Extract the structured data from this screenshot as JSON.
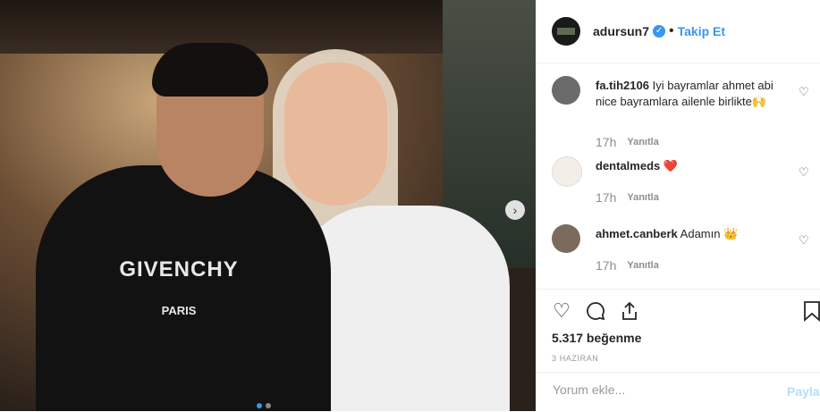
{
  "photo": {
    "shirt_logo": "GIVENCHY",
    "shirt_sub": "PARIS",
    "next_icon": "chevron-right-icon",
    "carousel_dots": 2,
    "active_dot": 0
  },
  "header": {
    "username": "adursun7",
    "verified_icon": "verified-badge-icon",
    "separator": "•",
    "follow_label": "Takip Et"
  },
  "comments": [
    {
      "username": "fa.tih2106",
      "text": "Iyi bayramlar ahmet abi nice bayramlara ailenle birlikte🙌",
      "time": "17h",
      "reply": "Yanıtla"
    },
    {
      "username": "dentalmeds",
      "text": "❤️",
      "time": "17h",
      "reply": "Yanıtla"
    },
    {
      "username": "ahmet.canberk",
      "text": "Adamın 👑",
      "time": "17h",
      "reply": "Yanıtla"
    }
  ],
  "actions": {
    "likes": "5.317 beğenme",
    "date": "3 HAZİRAN"
  },
  "composer": {
    "placeholder": "Yorum ekle...",
    "post_label": "Paylaş"
  },
  "colors": {
    "accent": "#3897f0",
    "text": "#262626",
    "muted": "#8e8e8e"
  }
}
